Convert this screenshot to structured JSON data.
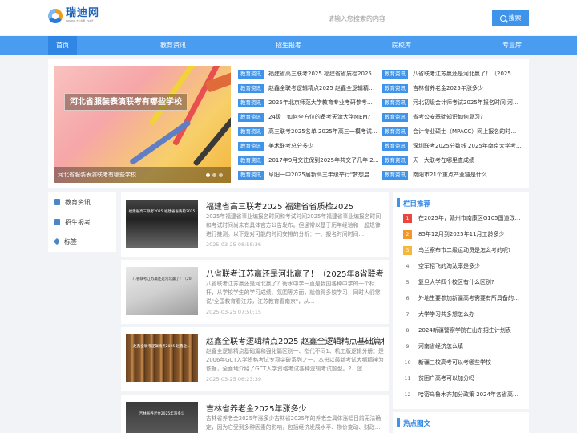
{
  "site": {
    "name": "瑞迪网",
    "url": "www.ruidi.net"
  },
  "search": {
    "placeholder": "请输入您搜索的内容",
    "button": "搜索"
  },
  "nav": [
    "首页",
    "教育资讯",
    "招生报考",
    "院校库",
    "专业库"
  ],
  "banner": {
    "title": "河北省服装表演联考有哪些学校",
    "caption": "河北省服装表演联考有哪些学校"
  },
  "news_left": [
    {
      "tag": "教育资讯",
      "title": "福建省高三联考2025 福建省省质检2025"
    },
    {
      "tag": "教育资讯",
      "title": "赵鑫全联考逻辑精点2025 赵鑫全逻辑精…"
    },
    {
      "tag": "教育资讯",
      "title": "2025年北京师范大学教育专业考研参考…"
    },
    {
      "tag": "教育资讯",
      "title": "24级｜如何全方位的备考天津大学MEM?"
    },
    {
      "tag": "教育资讯",
      "title": "高三联考2025名单 2025年高三一模考试…"
    },
    {
      "tag": "教育资讯",
      "title": "美术联考总分多少"
    },
    {
      "tag": "教育资讯",
      "title": "2017年9月交往保到2025年共交了几年 20…"
    },
    {
      "tag": "教育资讯",
      "title": "阜阳一中2025届新高三年级举行\"梦想启…"
    }
  ],
  "news_right": [
    {
      "tag": "教育资讯",
      "title": "八省联考江苏赢还是河北赢了！（2025…"
    },
    {
      "tag": "教育资讯",
      "title": "吉林省养老金2025年涨多少"
    },
    {
      "tag": "教育资讯",
      "title": "河北初级会计师考试2025年报名时间 河…"
    },
    {
      "tag": "教育资讯",
      "title": "省考公安基础知识如何复习?"
    },
    {
      "tag": "教育资讯",
      "title": "会计专业硕士（MPACC）网上报名的时…"
    },
    {
      "tag": "教育资讯",
      "title": "深圳联考2025分数线 2025年南京大学考…"
    },
    {
      "tag": "教育资讯",
      "title": "天一大联考在哪里查成绩"
    },
    {
      "tag": "教育资讯",
      "title": "南阳市21个重点产业链是什么"
    }
  ],
  "side_menu": [
    "教育资讯",
    "招生报考",
    "标签"
  ],
  "articles": [
    {
      "title": "福建省高三联考2025 福建省省质检2025",
      "thumb_label": "福建省高三联考2025 福建省省质检2025",
      "summary": "2025年福建省事业编报名时间和考试时间2025年福建省事业编报名时间和考试时间尚未有具体官方公告发布。但通常以基于历年经验和一般规律进行推测。以下是对可能的时间安排的分析：一、报名时间时间…",
      "date": "2025-03-25 08:58:36"
    },
    {
      "title": "八省联考江苏赢还是河北赢了！（2025年8省联考是…",
      "thumb_label": "八省联考江苏赢还是河北赢了！（20",
      "summary": "八省联考江苏赢还是河北赢了？衡水中学一直是我国各种中学的一个标杆，从学校学生的学习成绩、氛围等方面，就值得多校学习，同时人们常说\"全国教育看江苏，江苏教育看南京\"，从…",
      "date": "2025-03-25 07:50:15"
    },
    {
      "title": "赵鑫全联考逻辑精点2025 赵鑫全逻辑精点基础篇和强…",
      "thumb_label": "赵鑫全联考逻辑精点2025 赵鑫全…",
      "summary": "赵鑫全逻辑精点基础篇和强化篇区别一、指代不同1、机工版逻辑分册：是2006年GCT入学资格考试专项突破系列之一，本书以最新考试大纲精神为依据，全面地介绍了GCT入学资格考试各种逻辑考试题型。2、逻…",
      "date": "2025-03-25 06:23:39"
    },
    {
      "title": "吉林省养老金2025年涨多少",
      "thumb_label": "吉林省养老金2025年涨多少",
      "summary": "吉林省养老金2025年涨多少吉林省2025年的养老金具体涨幅目前无法确定，因为它受到多种因素的影响，包括经济发展水平、物价变动、财政…",
      "date": ""
    }
  ],
  "recommend": {
    "title": "栏目推荐",
    "items": [
      "在2025年，赣州市南康区G105国道改线…",
      "85年12月到2025年11月工龄多少",
      "乌兰察布市二级运动员是怎么考的呢?",
      "空军招飞的淘汰率是多少",
      "复旦大学四个校区有什么区别?",
      "外地生要参加新疆高考需要有所具备的所有条…",
      "大学学习共多想怎么办",
      "2024新疆警察学院在山东招生计划表",
      "河南省经济怎么填",
      "新疆三校高考可以考哪些学校",
      "贫困户高考可以加分吗",
      "哈密乌鲁木齐加分政策 2024年各省高考…"
    ]
  },
  "hot": {
    "title": "热点图文"
  },
  "colors": {
    "accent": "#3f93e8",
    "nav": "#4a9cf1",
    "rank1": "#e9473e",
    "rank2": "#f3962b",
    "rank3": "#f7b73a"
  }
}
